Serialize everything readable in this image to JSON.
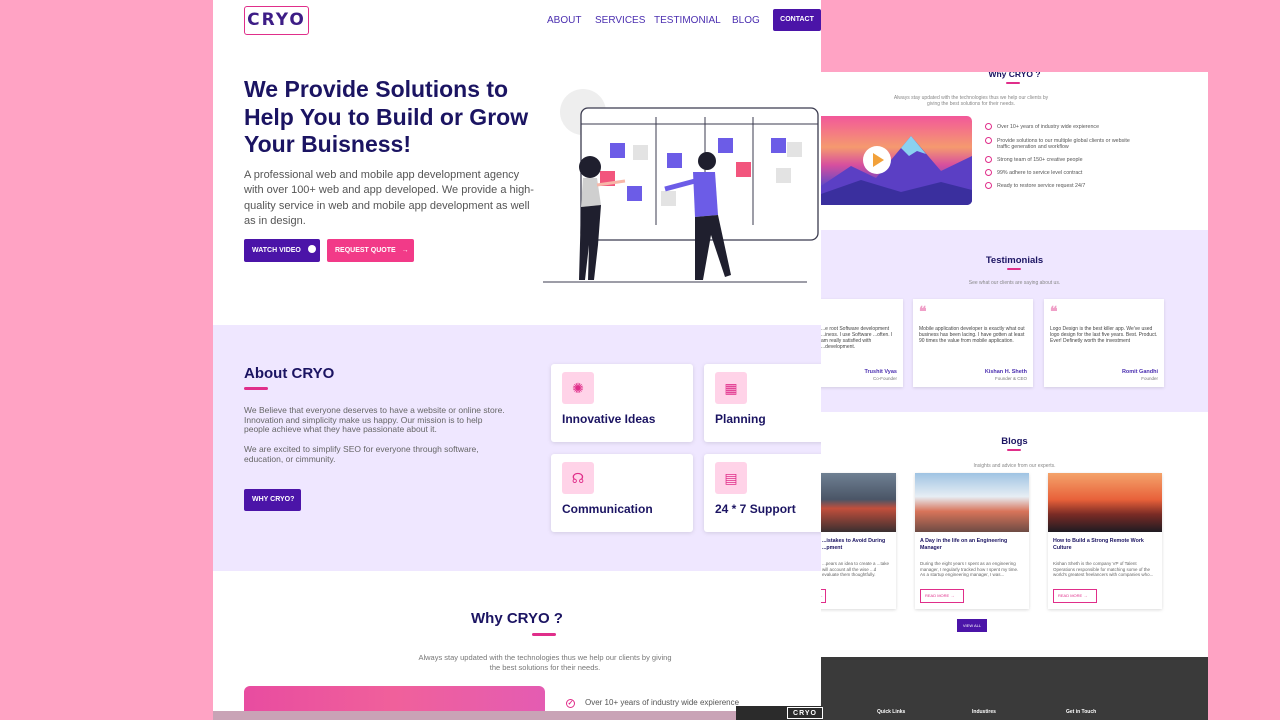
{
  "nav": {
    "logo": "CRYO",
    "links": [
      "ABOUT",
      "SERVICES",
      "TESTIMONIAL",
      "BLOG"
    ],
    "contact": "CONTACT"
  },
  "hero": {
    "title": "We Provide Solutions to Help You to Build or Grow Your Buisness!",
    "description": "A professional web and mobile app development agency with over 100+ web and app developed. We provide a high- quality service in web and mobile app development as well as in design.",
    "watch_video": "WATCH VIDEO",
    "request_quote": "REQUEST QUOTE"
  },
  "about": {
    "title": "About CRYO",
    "p1": "We Believe that everyone deserves to have a website or online store. Innovation and simplicity make us happy. Our mission is to help people achieve what they have passionate about it.",
    "p2": "We are excited to simplify SEO for everyone through software, education, or cimmunity.",
    "button": "WHY CRYO?",
    "cards": [
      "Innovative Ideas",
      "Planning",
      "Communication",
      "24 * 7 Support"
    ]
  },
  "why": {
    "title": "Why CRYO ?",
    "subtitle": "Always stay updated with the technologies thus we help our clients by giving the best solutions for their needs.",
    "points": [
      "Over 10+ years of industry wide expierence",
      "Provide solutions to our multiple global clients or website traffic generation and workflow",
      "Strong team of 150+ creative people",
      "99% adhere to service level contract",
      "Ready to restore service request 24/7"
    ]
  },
  "testimonials": {
    "title": "Testimonials",
    "subtitle": "See what our clients are saying about us.",
    "items": [
      {
        "text": "...e root Software development ...iness. I use Software ...often. I am really satisfied with ...development.",
        "name": "Trushit Vyas",
        "role": "Co-Founder"
      },
      {
        "text": "Mobile application developer is exactly what out business has been lacing. I have gotten at least 90 times the value from mobile application.",
        "name": "Kishan H. Sheth",
        "role": "Founder & CEO"
      },
      {
        "text": "Logo Design is the best killer app. We've used logo design for the last five years. Best. Product. Ever! Definetly worth the investment",
        "name": "Romit Gandhi",
        "role": "Founder"
      }
    ]
  },
  "blogs": {
    "title": "Blogs",
    "subtitle": "Insights and advice from our experts.",
    "items": [
      {
        "title": "...istakes to Avoid During ...pment",
        "desc": "...pears an idea to create a ...take will account all the wise ...d evaluate them thoughtfully.",
        "read": "READ MORE"
      },
      {
        "title": "A Day in the life on an Engineering Manager",
        "desc": "During the eight years I spent as an engineering manager, I regularly tracked how I spent my time. As a startup engineering manager, I was...",
        "read": "READ MORE"
      },
      {
        "title": "How to Build a Strong Remote Work Culture",
        "desc": "Kishan Sheth is the company VP of Talent Operations responsible for matching some of the world's greatest freelancers with companies who...",
        "read": "READ MORE"
      }
    ],
    "view_all": "VIEW ALL"
  },
  "footer": {
    "logo": "CRYO",
    "cols": [
      "Quick Links",
      "Industires",
      "Get in Touch"
    ]
  },
  "colors": {
    "primary": "#4b14a8",
    "accent": "#e02e8a",
    "navy": "#1b1462",
    "lavender": "#efe7ff",
    "backdrop": "#ffa3c4"
  }
}
